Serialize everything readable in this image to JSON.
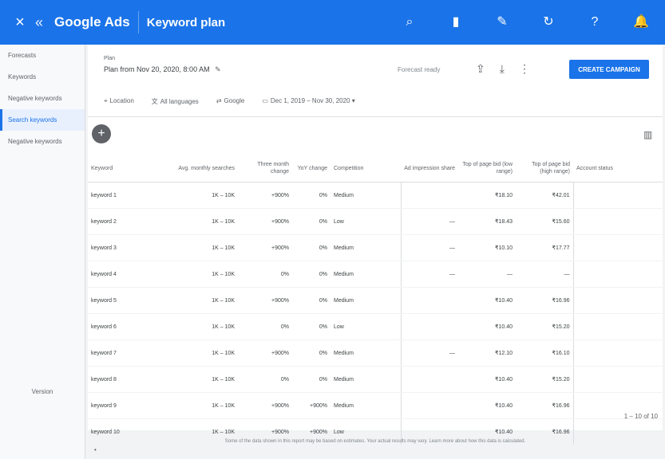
{
  "topbar": {
    "close_icon": "×",
    "back_icon": "«",
    "app_name": "Google Ads",
    "page_title": "Keyword plan",
    "buttons": [
      {
        "icon": "search-icon",
        "glyph": "⌕",
        "label": ""
      },
      {
        "icon": "reports-icon",
        "glyph": "▮",
        "label": ""
      },
      {
        "icon": "tools-icon",
        "glyph": "✎",
        "label": ""
      },
      {
        "icon": "refresh-icon",
        "glyph": "↻",
        "label": ""
      },
      {
        "icon": "help-icon",
        "glyph": "?",
        "label": ""
      },
      {
        "icon": "notifications-icon",
        "glyph": "🔔",
        "label": ""
      }
    ]
  },
  "sidebar": {
    "items": [
      {
        "label": "Forecasts",
        "active": false
      },
      {
        "label": "Keywords",
        "active": false
      },
      {
        "label": "Negative keywords",
        "active": false
      },
      {
        "label": "Search keywords",
        "active": true
      },
      {
        "label": "Negative keywords",
        "active": false
      }
    ],
    "bottom_label": "Version"
  },
  "plan": {
    "label": "Plan",
    "name": "Plan from Nov 20, 2020, 8:00 AM"
  },
  "header": {
    "forecast_status": "Forecast ready",
    "create_button": "CREATE CAMPAIGN"
  },
  "filters": [
    "Location",
    "All languages",
    "Google",
    "Dec 1, 2019 – Nov 30, 2020"
  ],
  "table": {
    "columns": [
      "Keyword",
      "Avg. monthly searches",
      "Three month change",
      "YoY change",
      "Competition",
      "Ad impression share",
      "Top of page bid (low range)",
      "Top of page bid (high range)",
      "Account status"
    ],
    "rows": [
      [
        "keyword 1",
        "1K – 10K",
        "+900%",
        "0%",
        "Medium",
        "",
        "₹18.10",
        "₹42.01"
      ],
      [
        "keyword 2",
        "1K – 10K",
        "+900%",
        "0%",
        "Low",
        "—",
        "₹18.43",
        "₹15.60"
      ],
      [
        "keyword 3",
        "1K – 10K",
        "+900%",
        "0%",
        "Medium",
        "—",
        "₹10.10",
        "₹17.77"
      ],
      [
        "keyword 4",
        "1K – 10K",
        "0%",
        "0%",
        "Medium",
        "—",
        "—",
        "—"
      ],
      [
        "keyword 5",
        "1K – 10K",
        "+900%",
        "0%",
        "Medium",
        "",
        "₹10.40",
        "₹16.96"
      ],
      [
        "keyword 6",
        "1K – 10K",
        "0%",
        "0%",
        "Low",
        "",
        "₹10.40",
        "₹15.20"
      ],
      [
        "keyword 7",
        "1K – 10K",
        "+900%",
        "0%",
        "Medium",
        "—",
        "₹12.10",
        "₹16.10"
      ],
      [
        "keyword 8",
        "1K – 10K",
        "0%",
        "0%",
        "Medium",
        "",
        "₹10.40",
        "₹15.20"
      ],
      [
        "keyword 9",
        "1K – 10K",
        "+900%",
        "+900%",
        "Medium",
        "",
        "₹10.40",
        "₹16.96"
      ],
      [
        "keyword 10",
        "1K – 10K",
        "+900%",
        "+900%",
        "Low",
        "",
        "₹10.40",
        "₹16.96"
      ]
    ]
  },
  "pagination": "1 – 10 of 10",
  "footer": {
    "note": "Some of the data shown in this report may be based on estimates. Your actual results may vary. Learn more about how this data is calculated."
  },
  "colors": {
    "accent": "#1a73e8",
    "sidebar_active_bg": "#e8f0fe"
  }
}
